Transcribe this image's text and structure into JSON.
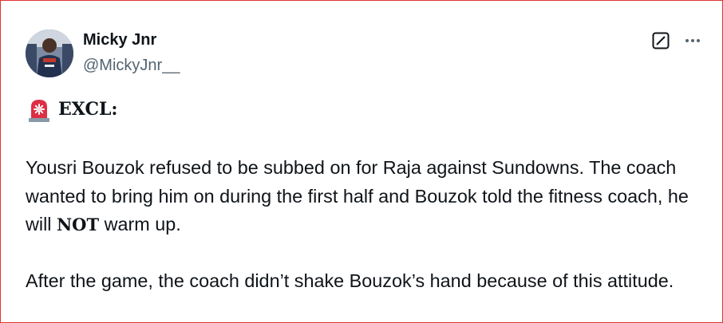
{
  "author": {
    "name": "Micky Jnr",
    "handle": "@MickyJnr__"
  },
  "icons": {
    "avatar": "avatar",
    "grok": "grok-icon",
    "more": "more-options-icon",
    "siren": "rotating-light-emoji-icon"
  },
  "tweet": {
    "excl_label": "EXCL:",
    "para1_before": "Yousri Bouzok refused to be subbed on for Raja against Sundowns. The coach wanted to bring him on during the first half and Bouzok told the fitness coach, he will ",
    "para1_bold": "NOT",
    "para1_after": " warm up.",
    "para2": "After the game, the coach didn’t shake Bouzok’s hand because of this attitude."
  },
  "colors": {
    "text_primary": "#0f1419",
    "text_secondary": "#536471",
    "frame_border": "#e0342f"
  }
}
